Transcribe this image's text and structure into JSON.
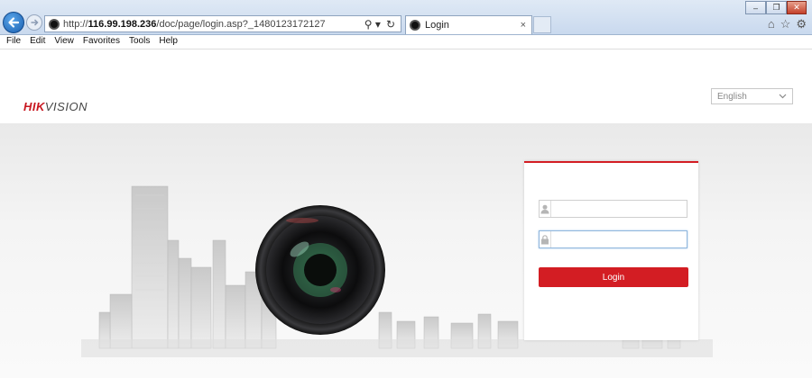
{
  "browser": {
    "address": {
      "prefix": "http://",
      "host": "116.99.198.236",
      "path": "/doc/page/login.asp?_1480123172127"
    },
    "tab": {
      "title": "Login",
      "close": "×"
    },
    "address_tools": [
      "⚲ ▾",
      "↻"
    ],
    "window_buttons": [
      "–",
      "❐",
      "✕"
    ]
  },
  "menu": [
    "File",
    "Edit",
    "View",
    "Favorites",
    "Tools",
    "Help"
  ],
  "header": {
    "logo_part1": "HIK",
    "logo_part2": "VISION",
    "language": "English"
  },
  "login": {
    "username_value": "",
    "password_value": "",
    "button_label": "Login",
    "accent_color": "#d31d23"
  }
}
